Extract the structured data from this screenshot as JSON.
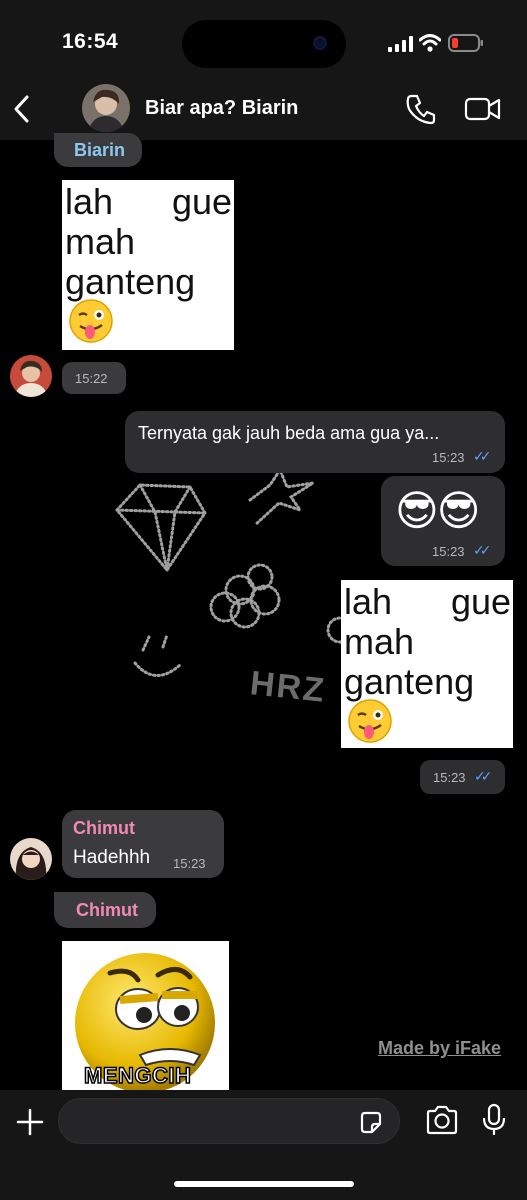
{
  "status": {
    "time": "16:54"
  },
  "header": {
    "chat_title": "Biar apa? Biarin"
  },
  "messages": {
    "m1": {
      "sender": "Biarin",
      "sticker_lines": [
        "lah",
        "gue",
        "mah",
        "ganteng"
      ],
      "time": "15:22"
    },
    "m2": {
      "text": "Ternyata gak jauh beda ama gua ya...",
      "time": "15:23"
    },
    "m3": {
      "emoji": "😎😎",
      "time": "15:23"
    },
    "m4": {
      "sticker_lines": [
        "lah",
        "gue",
        "mah",
        "ganteng"
      ],
      "time": "15:23"
    },
    "m5": {
      "sender": "Chimut",
      "text": "Hadehhh",
      "time": "15:23"
    },
    "m6": {
      "sender": "Chimut",
      "sticker_caption": "MENGCIH"
    }
  },
  "wallpaper": {
    "doodle_text": "HRZ"
  },
  "watermark": "Made by iFake",
  "colors": {
    "sender_biarin": "#8cc8f0",
    "sender_chimut": "#f08ab4",
    "read_ticks": "#5aa0ff"
  }
}
